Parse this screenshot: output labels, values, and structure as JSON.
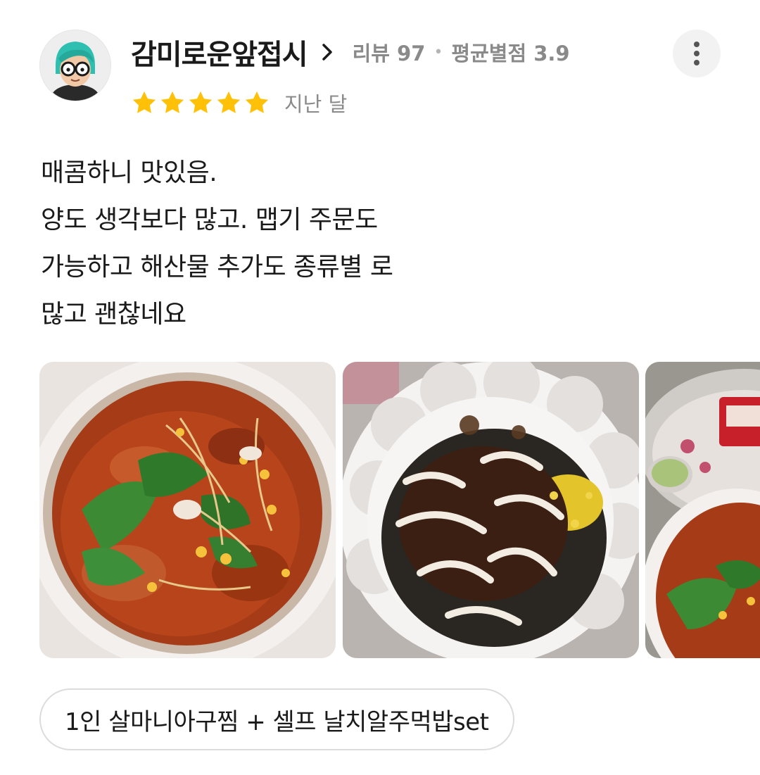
{
  "reviewer": {
    "avatar_icon": "avatar-glasses-teal-hair",
    "nickname": "감미로운앞접시",
    "review_count_label": "리뷰 97",
    "separator": "•",
    "average_rating_label": "평균별점 3.9"
  },
  "rating": {
    "stars": 5,
    "max_stars": 5,
    "star_color": "#FFC107",
    "date": "지난 달"
  },
  "review": {
    "lines": [
      "매콤하니 맛있음.",
      "양도 생각보다 많고. 맵기 주문도",
      "가능하고 해산물 추가도 종류별 로",
      "많고 괜찮네요"
    ]
  },
  "photos": [
    {
      "icon": "food-photo-spicy-seafood-stew"
    },
    {
      "icon": "food-photo-rice-ball-with-sauce"
    },
    {
      "icon": "food-photo-table-setting"
    }
  ],
  "ordered_menu": "1인 살마니아구찜 + 셀프 날치알주먹밥set",
  "more_icon": "more-vertical-icon"
}
